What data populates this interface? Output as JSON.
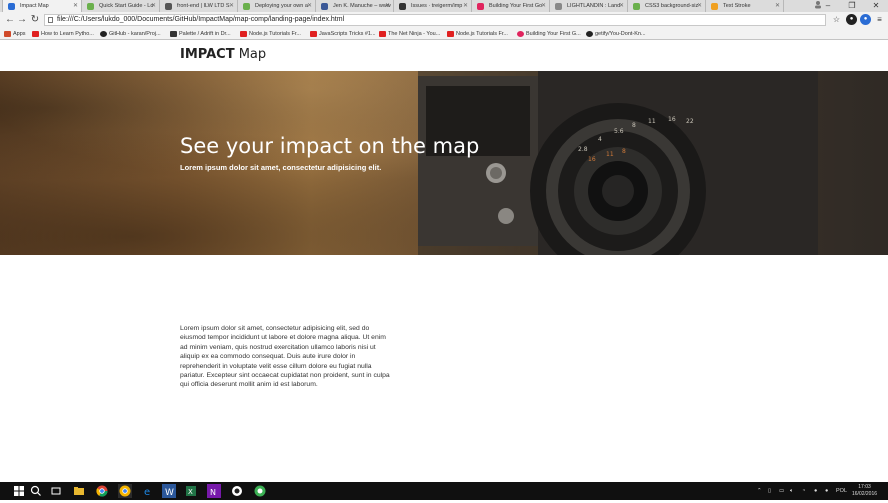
{
  "browser": {
    "tabs": [
      {
        "label": "Impact Map",
        "active": true,
        "color": "#2a6cd4"
      },
      {
        "label": "Quick Start Guide - Lo",
        "color": "#6ab04c"
      },
      {
        "label": "front-end | ILW LTD S",
        "color": "#555555"
      },
      {
        "label": "Deploying your own a",
        "color": "#6ab04c"
      },
      {
        "label": "Jen K. Manuche – www",
        "color": "#3b5998"
      },
      {
        "label": "Issues · treigerm/imp",
        "color": "#333333"
      },
      {
        "label": "Building Your First Go",
        "color": "#e0245e"
      },
      {
        "label": "LIGHTLANDIN : Land",
        "color": "#888888"
      },
      {
        "label": "CSS3 background-siz",
        "color": "#6ab04c"
      },
      {
        "label": "Text Stroke",
        "color": "#f0a020"
      }
    ],
    "address": "file:///C:/Users/lukdo_000/Documents/GitHub/ImpactMap/map-comp/landing-page/index.html",
    "bookmarks": [
      {
        "label": "Apps",
        "color": "#d04a2a"
      },
      {
        "label": "How to Learn Pytho...",
        "color": "#e02020"
      },
      {
        "label": "GitHub - karan/Proj...",
        "color": "#222222"
      },
      {
        "label": "Palette / Adrift in Dr...",
        "color": "#333333"
      },
      {
        "label": "Node.js Tutorials Fr...",
        "color": "#e02020"
      },
      {
        "label": "JavaScripts Tricks #1...",
        "color": "#e02020"
      },
      {
        "label": "The Net Ninja - You...",
        "color": "#e02020"
      },
      {
        "label": "Node.js Tutorials Fr...",
        "color": "#e02020"
      },
      {
        "label": "Building Your First G...",
        "color": "#e0245e"
      },
      {
        "label": "getify/You-Dont-Kn...",
        "color": "#222222"
      }
    ]
  },
  "page": {
    "brand_bold": "IMPACT",
    "brand_rest": " Map",
    "hero_title": "See your impact on the map",
    "hero_subtitle": "Lorem ipsum dolor sit amet, consectetur adipisicing elit.",
    "body_text": "Lorem ipsum dolor sit amet, consectetur adipisicing elit, sed do eiusmod tempor incididunt ut labore et dolore magna aliqua. Ut enim ad minim veniam, quis nostrud exercitation ullamco laboris nisi ut aliquip ex ea commodo consequat. Duis aute irure dolor in reprehenderit in voluptate velit esse cillum dolore eu fugiat nulla pariatur. Excepteur sint occaecat cupidatat non proident, sunt in culpa qui officia deserunt mollit anim id est laborum."
  },
  "taskbar": {
    "language": "POL",
    "time": "17:03",
    "date": "16/02/2016"
  }
}
